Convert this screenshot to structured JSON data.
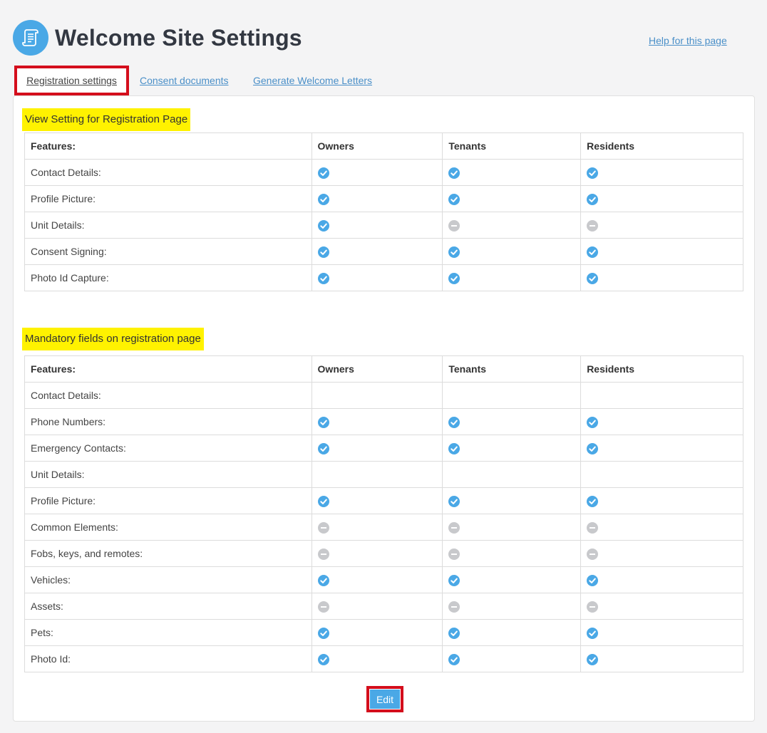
{
  "page": {
    "title": "Welcome Site Settings",
    "help_link": "Help for this page",
    "icon": "scroll-document-icon"
  },
  "tabs": [
    {
      "label": "Registration settings",
      "active": true
    },
    {
      "label": "Consent documents",
      "active": false
    },
    {
      "label": "Generate Welcome Letters",
      "active": false
    }
  ],
  "colors": {
    "accent": "#4aa8e6",
    "link": "#4a8fc8",
    "highlight": "#fff200",
    "annotation_box": "#d40e1c",
    "disabled_icon": "#c8c9cc"
  },
  "view_settings": {
    "heading": "View Setting for Registration Page",
    "columns": [
      "Features:",
      "Owners",
      "Tenants",
      "Residents"
    ],
    "rows": [
      {
        "label": "Contact Details:",
        "owners": "enabled",
        "tenants": "enabled",
        "residents": "enabled"
      },
      {
        "label": "Profile Picture:",
        "owners": "enabled",
        "tenants": "enabled",
        "residents": "enabled"
      },
      {
        "label": "Unit Details:",
        "owners": "enabled",
        "tenants": "disabled",
        "residents": "disabled"
      },
      {
        "label": "Consent Signing:",
        "owners": "enabled",
        "tenants": "enabled",
        "residents": "enabled"
      },
      {
        "label": "Photo Id Capture:",
        "owners": "enabled",
        "tenants": "enabled",
        "residents": "enabled"
      }
    ]
  },
  "mandatory_fields": {
    "heading": "Mandatory fields on registration page",
    "columns": [
      "Features:",
      "Owners",
      "Tenants",
      "Residents"
    ],
    "rows": [
      {
        "label": "Contact Details:",
        "indent": false,
        "owners": "none",
        "tenants": "none",
        "residents": "none"
      },
      {
        "label": "Phone Numbers:",
        "indent": true,
        "owners": "enabled",
        "tenants": "enabled",
        "residents": "enabled"
      },
      {
        "label": "Emergency Contacts:",
        "indent": true,
        "owners": "enabled",
        "tenants": "enabled",
        "residents": "enabled"
      },
      {
        "label": "Unit Details:",
        "indent": false,
        "owners": "none",
        "tenants": "none",
        "residents": "none"
      },
      {
        "label": "Profile Picture:",
        "indent": true,
        "owners": "enabled",
        "tenants": "enabled",
        "residents": "enabled"
      },
      {
        "label": "Common Elements:",
        "indent": true,
        "owners": "disabled",
        "tenants": "disabled",
        "residents": "disabled"
      },
      {
        "label": "Fobs, keys, and remotes:",
        "indent": true,
        "owners": "disabled",
        "tenants": "disabled",
        "residents": "disabled"
      },
      {
        "label": "Vehicles:",
        "indent": true,
        "owners": "enabled",
        "tenants": "enabled",
        "residents": "enabled"
      },
      {
        "label": "Assets:",
        "indent": true,
        "owners": "disabled",
        "tenants": "disabled",
        "residents": "disabled"
      },
      {
        "label": "Pets:",
        "indent": true,
        "owners": "enabled",
        "tenants": "enabled",
        "residents": "enabled"
      },
      {
        "label": "Photo Id:",
        "indent": false,
        "owners": "enabled",
        "tenants": "enabled",
        "residents": "enabled"
      }
    ]
  },
  "actions": {
    "edit_label": "Edit"
  }
}
